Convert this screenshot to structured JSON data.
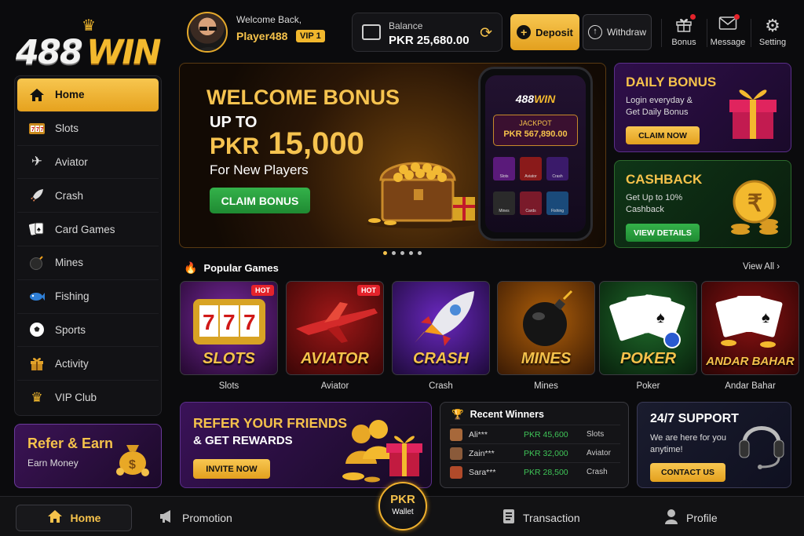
{
  "brand": {
    "logo_num": "488",
    "logo_word": "WIN"
  },
  "user": {
    "welcome": "Welcome Back,",
    "name": "Player488",
    "vip": "VIP 1"
  },
  "balance": {
    "label": "Balance",
    "value": "PKR 25,680.00"
  },
  "actions": {
    "deposit": "Deposit",
    "withdraw": "Withdraw"
  },
  "header_icons": [
    {
      "label": "Bonus",
      "icon": "gift-icon",
      "badge": true
    },
    {
      "label": "Message",
      "icon": "mail-icon",
      "badge": true
    },
    {
      "label": "Setting",
      "icon": "gear-icon",
      "badge": false
    }
  ],
  "sidebar": {
    "items": [
      {
        "label": "Home",
        "icon": "home-icon",
        "active": true
      },
      {
        "label": "Slots",
        "icon": "slots-icon"
      },
      {
        "label": "Aviator",
        "icon": "plane-icon"
      },
      {
        "label": "Crash",
        "icon": "rocket-icon"
      },
      {
        "label": "Card Games",
        "icon": "cards-icon"
      },
      {
        "label": "Mines",
        "icon": "bomb-icon"
      },
      {
        "label": "Fishing",
        "icon": "fish-icon"
      },
      {
        "label": "Sports",
        "icon": "soccer-icon"
      },
      {
        "label": "Activity",
        "icon": "gift-icon"
      },
      {
        "label": "VIP Club",
        "icon": "crown-icon"
      }
    ],
    "refer": {
      "title": "Refer & Earn",
      "sub": "Earn Money"
    }
  },
  "banner": {
    "title": "WELCOME BONUS",
    "upto": "UP TO",
    "currency": "PKR",
    "amount": "15,000",
    "sub": "For New Players",
    "cta": "CLAIM BONUS",
    "phone_logo_num": "488",
    "phone_logo_word": "WIN",
    "jackpot_label": "JACKPOT",
    "jackpot_value": "PKR 567,890.00",
    "phone_games": [
      "Slots",
      "Aviator",
      "Crash",
      "Mines",
      "Cards",
      "Fishing"
    ],
    "slides": 5,
    "active_slide": 1
  },
  "daily": {
    "title": "DAILY BONUS",
    "sub": "Login everyday & Get Daily Bonus",
    "cta": "CLAIM NOW"
  },
  "cashback": {
    "title": "CASHBACK",
    "sub": "Get Up to 10% Cashback",
    "cta": "VIEW DETAILS"
  },
  "popular": {
    "title": "Popular Games",
    "view_all": "View All ›",
    "games": [
      {
        "title": "SLOTS",
        "caption": "Slots",
        "hot": "HOT"
      },
      {
        "title": "AVIATOR",
        "caption": "Aviator",
        "hot": "HOT"
      },
      {
        "title": "CRASH",
        "caption": "Crash",
        "hot": ""
      },
      {
        "title": "MINES",
        "caption": "Mines",
        "hot": ""
      },
      {
        "title": "POKER",
        "caption": "Poker",
        "hot": ""
      },
      {
        "title": "ANDAR BAHAR",
        "caption": "Andar Bahar",
        "hot": ""
      }
    ]
  },
  "refer_banner": {
    "title": "REFER YOUR FRIENDS",
    "sub": "& GET REWARDS",
    "cta": "INVITE NOW"
  },
  "winners": {
    "title": "Recent Winners",
    "rows": [
      {
        "name": "Ali***",
        "amount": "PKR 45,600",
        "game": "Slots"
      },
      {
        "name": "Zain***",
        "amount": "PKR 32,000",
        "game": "Aviator"
      },
      {
        "name": "Sara***",
        "amount": "PKR 28,500",
        "game": "Crash"
      }
    ]
  },
  "support": {
    "title": "24/7 SUPPORT",
    "sub": "We are here for you anytime!",
    "cta": "CONTACT US"
  },
  "bottom_nav": {
    "home": "Home",
    "promotion": "Promotion",
    "wallet_top": "PKR",
    "wallet_bottom": "Wallet",
    "transaction": "Transaction",
    "profile": "Profile"
  },
  "colors": {
    "accent": "#f5c24b",
    "green": "#2ea043",
    "hot": "#e4232b",
    "bg": "#0b0b0d"
  }
}
